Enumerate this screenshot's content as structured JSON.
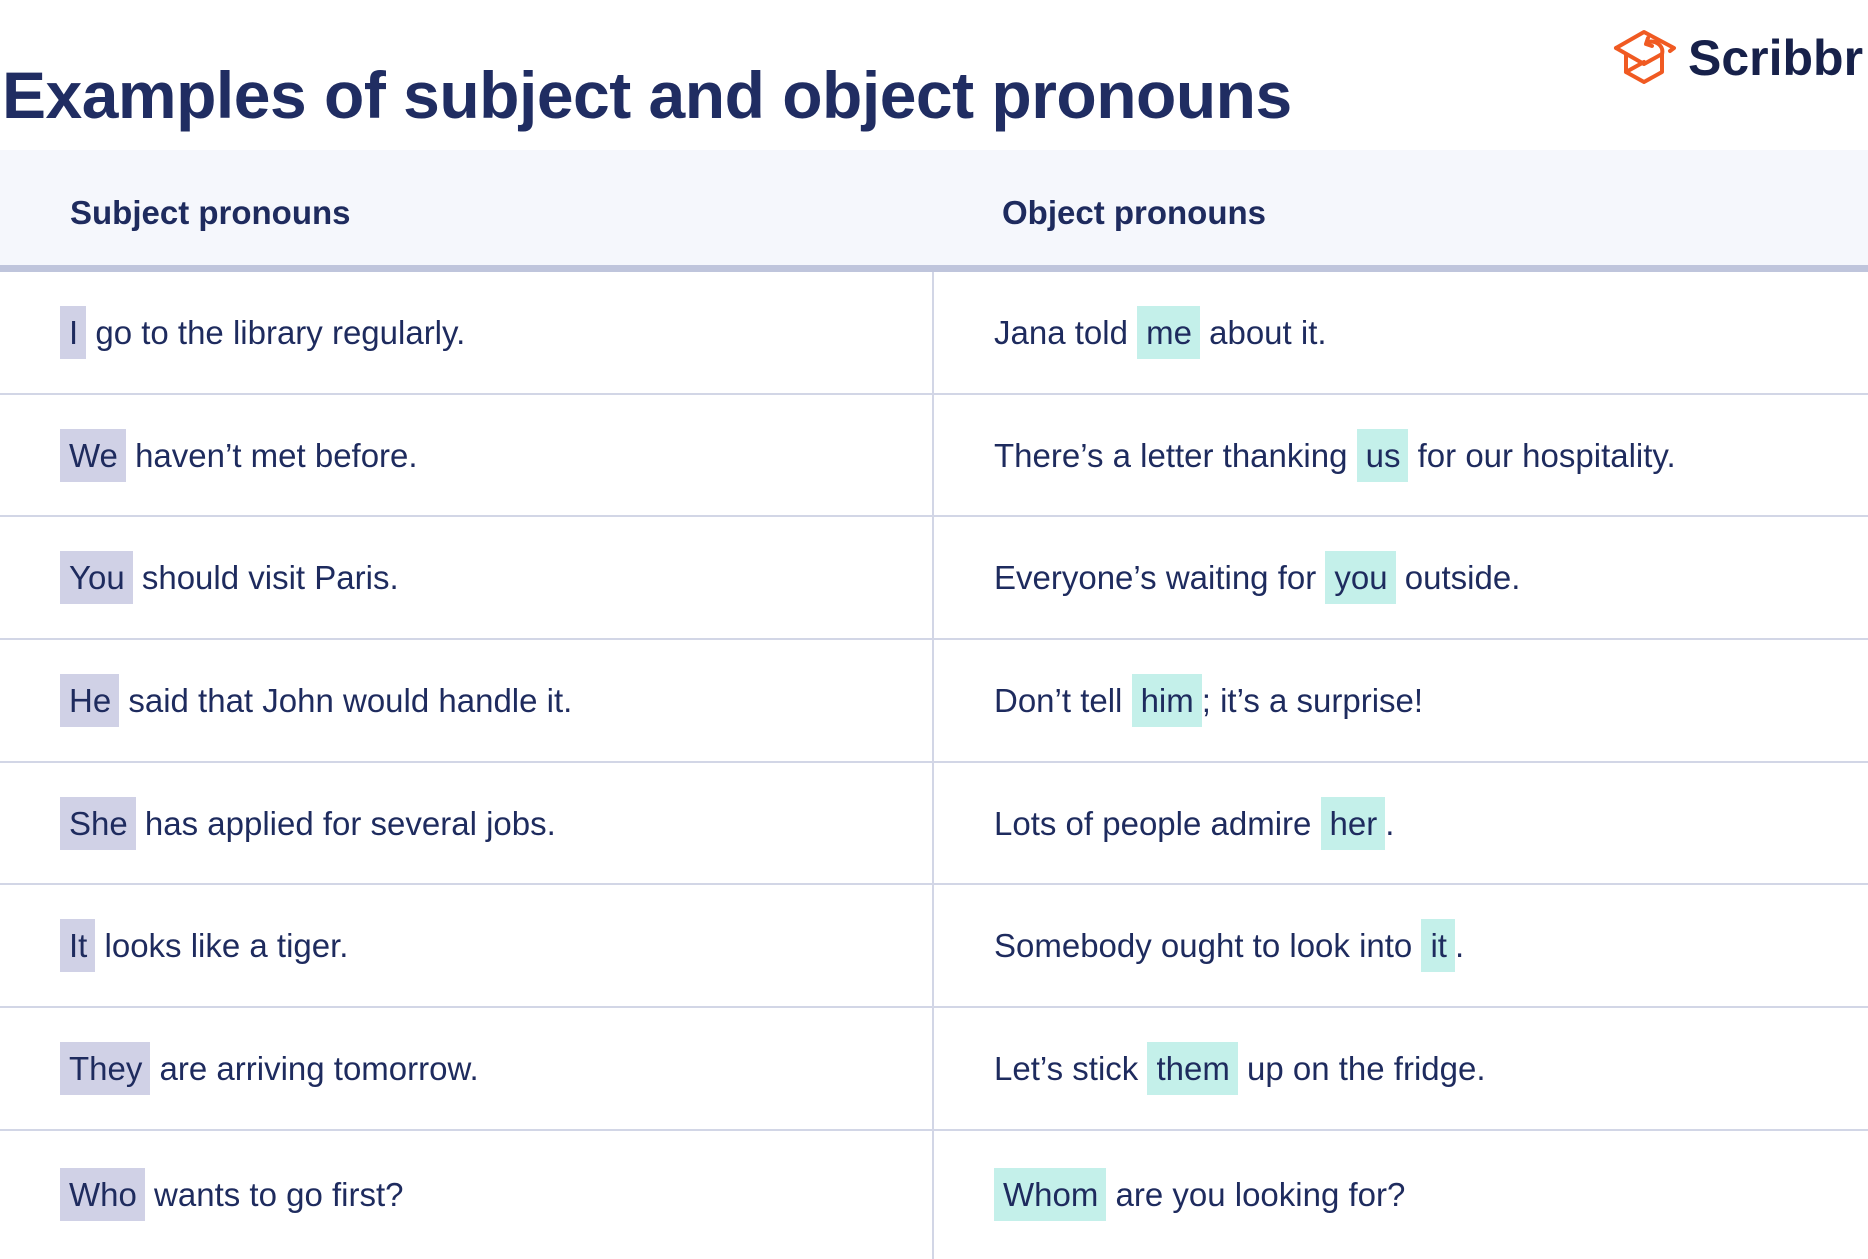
{
  "title": "Examples of subject and object pronouns",
  "logo": {
    "icon": "graduation-cap-icon",
    "text": "Scribbr",
    "color": "#f05a22",
    "text_color": "#17214a"
  },
  "colors": {
    "text": "#1e2b5e",
    "header_bg": "#f5f7fc",
    "header_rule": "#bfc5dc",
    "row_rule": "#d2d6e6",
    "subject_highlight": "#d0d1e6",
    "object_highlight": "#c4f0ea"
  },
  "table": {
    "headers": [
      "Subject pronouns",
      "Object pronouns"
    ],
    "rows": [
      {
        "subject": {
          "before": "",
          "pronoun": "I",
          "after": " go to the library regularly."
        },
        "object": {
          "before": "Jana told ",
          "pronoun": "me",
          "after": " about it."
        }
      },
      {
        "subject": {
          "before": "",
          "pronoun": "We",
          "after": " haven’t met before."
        },
        "object": {
          "before": "There’s a letter thanking ",
          "pronoun": "us",
          "after": " for our hospitality."
        }
      },
      {
        "subject": {
          "before": "",
          "pronoun": "You",
          "after": " should visit Paris."
        },
        "object": {
          "before": "Everyone’s waiting for ",
          "pronoun": "you",
          "after": " outside."
        }
      },
      {
        "subject": {
          "before": "",
          "pronoun": "He",
          "after": " said that John would handle it."
        },
        "object": {
          "before": "Don’t tell ",
          "pronoun": "him",
          "after": "; it’s a surprise!"
        }
      },
      {
        "subject": {
          "before": "",
          "pronoun": "She",
          "after": " has applied for several jobs."
        },
        "object": {
          "before": "Lots of people admire ",
          "pronoun": "her",
          "after": "."
        }
      },
      {
        "subject": {
          "before": "",
          "pronoun": "It",
          "after": " looks like a tiger."
        },
        "object": {
          "before": "Somebody ought to look into ",
          "pronoun": "it",
          "after": "."
        }
      },
      {
        "subject": {
          "before": "",
          "pronoun": "They",
          "after": " are arriving tomorrow."
        },
        "object": {
          "before": "Let’s stick ",
          "pronoun": "them",
          "after": " up on the fridge."
        }
      },
      {
        "subject": {
          "before": "",
          "pronoun": "Who",
          "after": " wants to go first?"
        },
        "object": {
          "before": "",
          "pronoun": "Whom",
          "after": " are you looking for?"
        }
      }
    ]
  }
}
